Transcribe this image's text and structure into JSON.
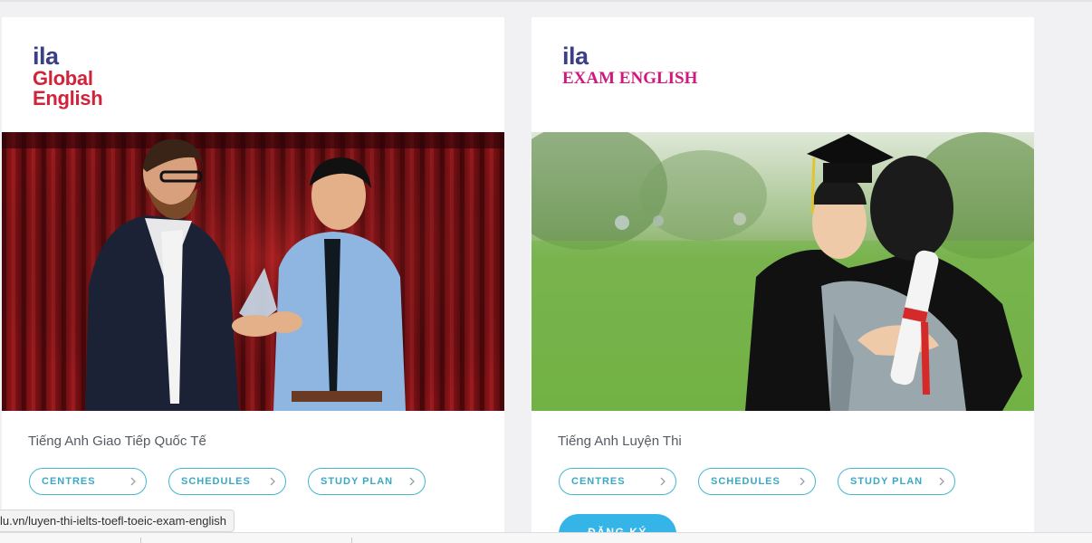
{
  "cards": [
    {
      "logo_top": "ila",
      "logo_line1": "Global",
      "logo_line2": "English",
      "title": "Tiếng Anh Giao Tiếp Quốc Tế",
      "buttons": [
        "CENTRES",
        "SCHEDULES",
        "STUDY PLAN"
      ]
    },
    {
      "logo_top": "ila",
      "logo_line1": "EXAM ENGLISH",
      "title": "Tiếng Anh Luyện Thi",
      "buttons": [
        "CENTRES",
        "SCHEDULES",
        "STUDY PLAN"
      ],
      "cta": "ĐĂNG KÝ"
    }
  ],
  "status_url": "lu.vn/luyen-thi-ielts-toefl-toeic-exam-english",
  "colors": {
    "ila_blue": "#3a3f86",
    "global_red": "#d1233a",
    "exam_pink": "#d0187d",
    "button_teal": "#42b8cf",
    "cta_blue": "#35b4e8"
  },
  "icons": [
    "chevron-right-icon"
  ]
}
